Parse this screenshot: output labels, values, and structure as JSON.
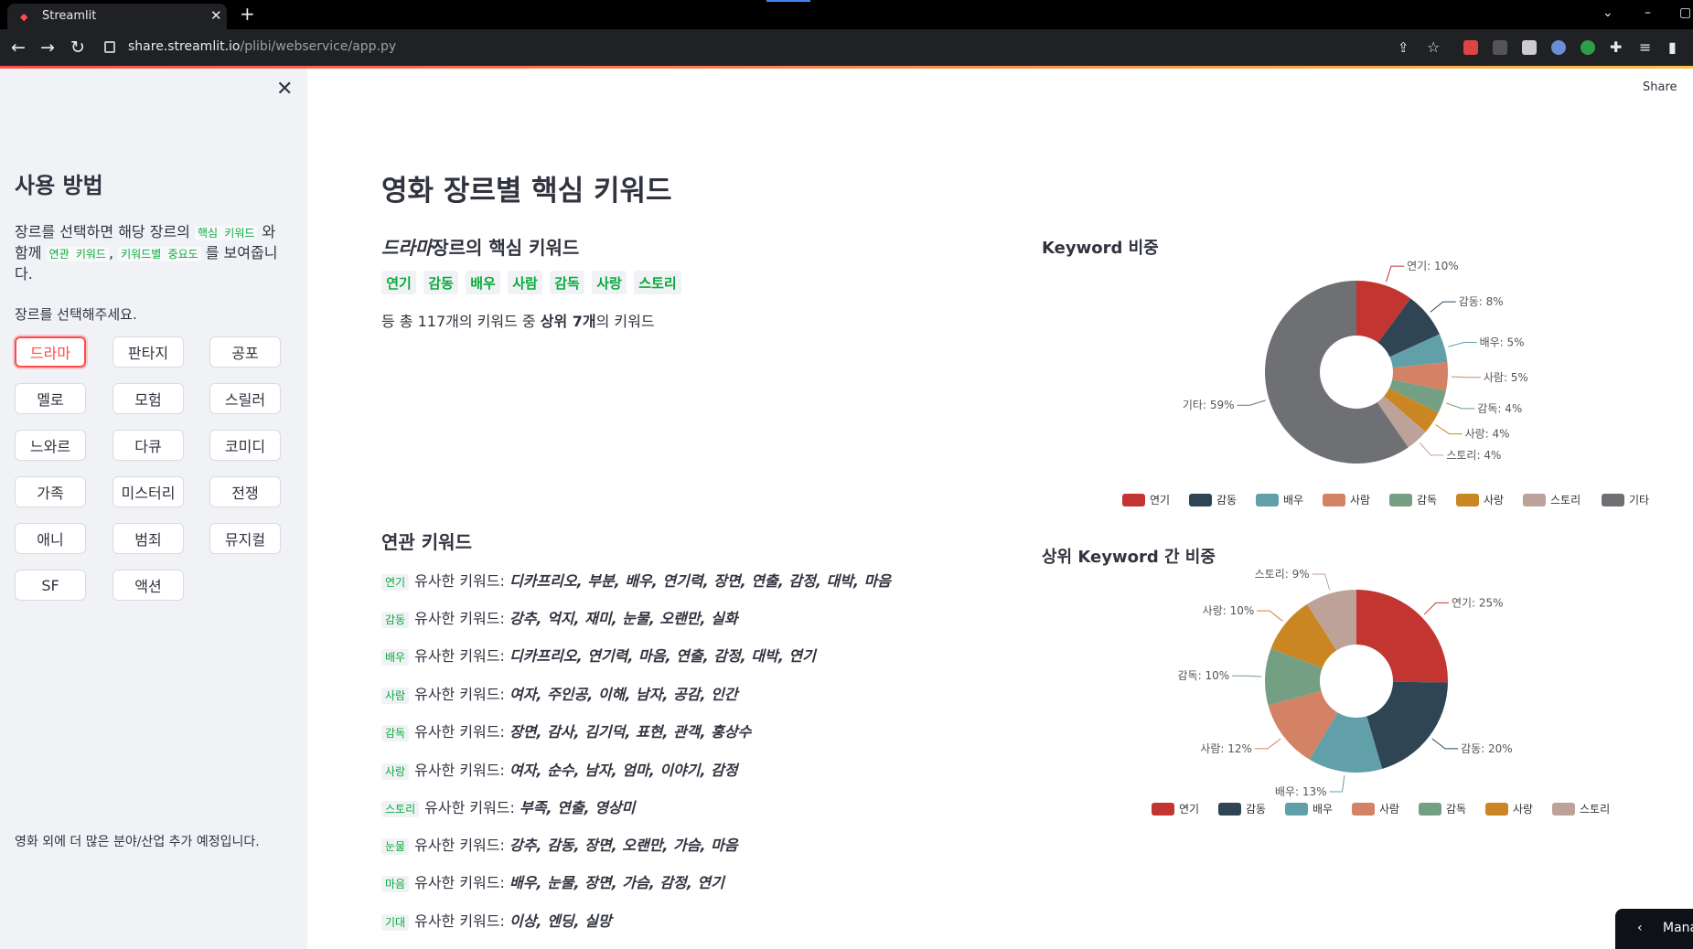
{
  "browser": {
    "tab_title": "Streamlit",
    "url_host": "share.streamlit.io",
    "url_path": "/plibi/webservice/app.py"
  },
  "sidebar": {
    "heading": "사용 방법",
    "desc_1": "장르를 선택하면 해당 장르의 ",
    "code_core": "핵심 키워드",
    "desc_2": " 와 함께 ",
    "code_related": "연관 키워드",
    "desc_3": ", ",
    "code_importance": "키워드별 중요도",
    "desc_4": " 를 보여줍니다.",
    "select_label": "장르를 선택해주세요.",
    "genres": [
      "드라마",
      "판타지",
      "공포",
      "멜로",
      "모험",
      "스릴러",
      "느와르",
      "다큐",
      "코미디",
      "가족",
      "미스터리",
      "전쟁",
      "애니",
      "범죄",
      "뮤지컬",
      "SF",
      "액션"
    ],
    "footer": "영화 외에 더 많은 분야/산업 추가 예정입니다."
  },
  "main": {
    "share": "Share",
    "title": "영화 장르별 핵심 키워드",
    "subheading_genre": "드라마",
    "subheading_rest": "장르의 핵심 키워드",
    "keywords": [
      "연기",
      "감동",
      "배우",
      "사람",
      "감독",
      "사랑",
      "스토리"
    ],
    "total_1": "등 총 117개의 키워드 중 ",
    "total_bold": "상위 7개",
    "total_2": "의 키워드",
    "related_heading": "연관 키워드",
    "related_prefix": "유사한 키워드: ",
    "related": [
      {
        "kw": "연기",
        "list": "디카프리오, 부분, 배우, 연기력, 장면, 연출, 감정, 대박, 마음"
      },
      {
        "kw": "감동",
        "list": "강추, 억지, 재미, 눈물, 오랜만, 실화"
      },
      {
        "kw": "배우",
        "list": "디카프리오, 연기력, 마음, 연출, 감정, 대박, 연기"
      },
      {
        "kw": "사람",
        "list": "여자, 주인공, 이해, 남자, 공감, 인간"
      },
      {
        "kw": "감독",
        "list": "장면, 감사, 김기덕, 표현, 관객, 홍상수"
      },
      {
        "kw": "사랑",
        "list": "여자, 순수, 남자, 엄마, 이야기, 감정"
      },
      {
        "kw": "스토리",
        "list": "부족, 연출, 영상미"
      },
      {
        "kw": "눈물",
        "list": "강추, 감동, 장면, 오랜만, 가슴, 마음"
      },
      {
        "kw": "마음",
        "list": "배우, 눈물, 장면, 가슴, 감정, 연기"
      },
      {
        "kw": "기대",
        "list": "이상, 엔딩, 실망"
      }
    ],
    "manage_label": "Mana"
  },
  "chart_data": [
    {
      "type": "pie",
      "title": "Keyword 비중",
      "categories": [
        "연기",
        "감동",
        "배우",
        "사람",
        "감독",
        "사랑",
        "스토리",
        "기타"
      ],
      "values": [
        10,
        8,
        5,
        5,
        4,
        4,
        4,
        59
      ],
      "labels": [
        "연기: 10%",
        "감동: 8%",
        "배우: 5%",
        "사람: 5%",
        "감독: 4%",
        "사랑: 4%",
        "스토리: 4%",
        "기타: 59%"
      ],
      "colors": [
        "#c23531",
        "#2f4554",
        "#61a0a8",
        "#d48265",
        "#749f83",
        "#ca8622",
        "#bda29a",
        "#6e7074"
      ],
      "legend": "bottom"
    },
    {
      "type": "pie",
      "title": "상위 Keyword 간 비중",
      "categories": [
        "연기",
        "감동",
        "배우",
        "사람",
        "감독",
        "사랑",
        "스토리"
      ],
      "values": [
        25,
        20,
        13,
        12,
        10,
        10,
        9
      ],
      "labels": [
        "연기: 25%",
        "감동: 20%",
        "배우: 13%",
        "사람: 12%",
        "감독: 10%",
        "사랑: 10%",
        "스토리: 9%"
      ],
      "colors": [
        "#c23531",
        "#2f4554",
        "#61a0a8",
        "#d48265",
        "#749f83",
        "#ca8622",
        "#bda29a"
      ],
      "legend": "bottom"
    }
  ]
}
